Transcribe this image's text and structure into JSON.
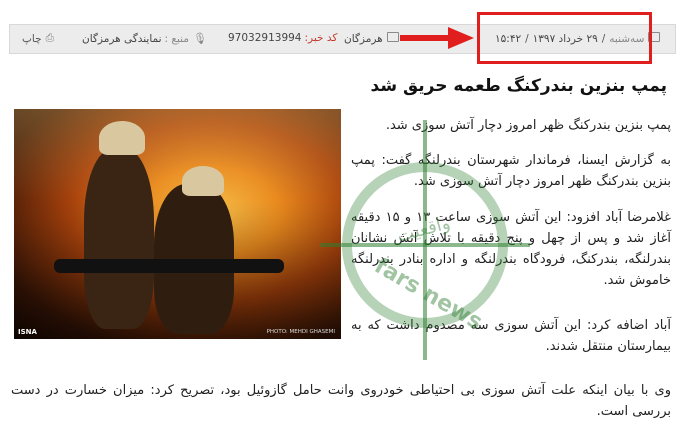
{
  "meta": {
    "day": "سه‌شنبه",
    "date": "۲۹ خرداد ۱۳۹۷",
    "separator": "/",
    "time": "۱۵:۴۲",
    "source_partial": "هرمزگان",
    "code_label": "کد خبر:",
    "code_value": "97032913994",
    "source_label": "منبع :",
    "source_value": "نمایندگی هرمزگان",
    "print_label": "چاپ"
  },
  "article": {
    "title": "پمپ بنزین بندرکنگ طعمه حریق شد",
    "paragraphs": [
      "پمپ بنزین بندرکنگ ظهر امروز دچار آتش سوزی شد.",
      "به گزارش ایسنا، فرماندار شهرستان بندرلنگه گفت: پمپ بنزین بندرکنگ ظهر امروز دچار آتش سوزی شد.",
      "غلامرضا آباد افزود: این آتش سوزی ساعت ۱۳ و ۱۵ دقیقه آغاز شد و پس از چهل و پنج دقیقه با تلاش آتش نشانان بندرلنگه، بندرکنگ، فرودگاه بندرلنگه و اداره بنادر بندرلنگه خاموش شد.",
      "آباد اضافه کرد: این آتش سوزی سه مصدوم داشت که به بیمارستان منتقل شدند.",
      "وی با بیان اینکه علت آتش سوزی بی احتیاطی خودروی وانت حامل گازوئیل بود، تصریح کرد: میزان خسارت در دست بررسی است."
    ]
  },
  "photo": {
    "tag": "ISNA",
    "credit": "PHOTO: MEHDI GHASEMI"
  },
  "watermark": {
    "top_text": "واقعیت",
    "bottom_text": "fars news"
  },
  "colors": {
    "highlight": "#e01e1e",
    "code_label": "#c0392b",
    "watermark": "#2e7d32"
  }
}
